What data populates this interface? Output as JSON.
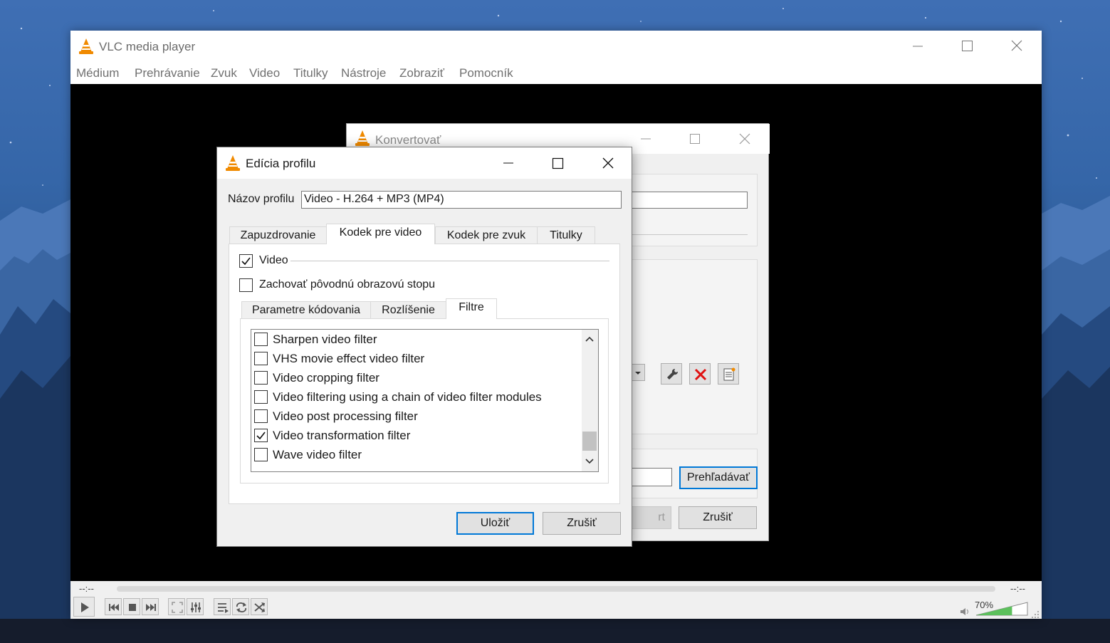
{
  "vlc": {
    "title": "VLC media player",
    "menu": [
      "Médium",
      "Prehrávanie",
      "Zvuk",
      "Video",
      "Titulky",
      "Nástroje",
      "Zobraziť",
      "Pomocník"
    ],
    "time_left": "--:--",
    "time_right": "--:--",
    "volume": "70%",
    "volume_level": 0.7
  },
  "convert": {
    "title": "Konvertovať",
    "browse_label": "Prehľadávať",
    "start_partial": "rt",
    "cancel_label": "Zrušiť"
  },
  "profile": {
    "title": "Edícia profilu",
    "name_label": "Názov profilu",
    "name_value": "Video - H.264 + MP3 (MP4)",
    "tabs": [
      "Zapuzdrovanie",
      "Kodek pre video",
      "Kodek pre zvuk",
      "Titulky"
    ],
    "video_label": "Video",
    "keep_label": "Zachovať pôvodnú obrazovú stopu",
    "subtabs": [
      "Parametre kódovania",
      "Rozlíšenie",
      "Filtre"
    ],
    "filters": [
      {
        "label": "Sharpen video filter",
        "checked": false
      },
      {
        "label": "VHS movie effect video filter",
        "checked": false
      },
      {
        "label": "Video cropping filter",
        "checked": false
      },
      {
        "label": "Video filtering using a chain of video filter modules",
        "checked": false
      },
      {
        "label": "Video post processing filter",
        "checked": false
      },
      {
        "label": "Video transformation filter",
        "checked": true
      },
      {
        "label": "Wave video filter",
        "checked": false
      }
    ],
    "save_label": "Uložiť",
    "cancel_label": "Zrušiť"
  }
}
